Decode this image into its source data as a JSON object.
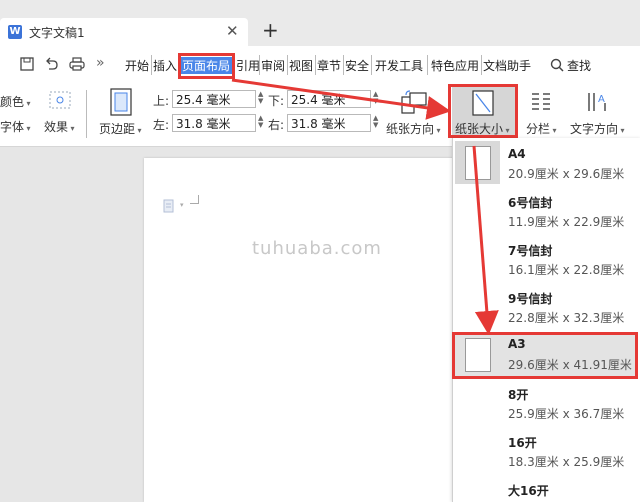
{
  "titlebar": {
    "doc_title": "文字文稿1",
    "close": "✕",
    "new_tab": "+",
    "logo": "W"
  },
  "menu": {
    "overflow": "»",
    "items": [
      "开始",
      "插入",
      "页面布局",
      "引用",
      "审阅",
      "视图",
      "章节",
      "安全",
      "开发工具",
      "特色应用",
      "文档助手"
    ],
    "active": "页面布局",
    "search": "查找"
  },
  "ribbon": {
    "color_label": "颜色",
    "font_label": "字体",
    "effect_label": "效果",
    "margins_label": "页边距",
    "top_label": "上:",
    "top_value": "25.4 毫米",
    "bottom_label": "下:",
    "bottom_value": "25.4 毫米",
    "left_label": "左:",
    "left_value": "31.8 毫米",
    "right_label": "右:",
    "right_value": "31.8 毫米",
    "orientation_label": "纸张方向",
    "size_label": "纸张大小",
    "columns_label": "分栏",
    "text_direction_label": "文字方向"
  },
  "watermark": "tuhuaba.com",
  "paper_sizes": [
    {
      "name": "A4",
      "width": "20.9厘米",
      "height": "29.6厘米"
    },
    {
      "name": "6号信封",
      "width": "11.9厘米",
      "height": "22.9厘米"
    },
    {
      "name": "7号信封",
      "width": "16.1厘米",
      "height": "22.8厘米"
    },
    {
      "name": "9号信封",
      "width": "22.8厘米",
      "height": "32.3厘米"
    },
    {
      "name": "A3",
      "width": "29.6厘米",
      "height": "41.91厘米"
    },
    {
      "name": "8开",
      "width": "25.9厘米",
      "height": "36.7厘米"
    },
    {
      "name": "16开",
      "width": "18.3厘米",
      "height": "25.9厘米"
    },
    {
      "name": "大16开",
      "width": "",
      "height": ""
    }
  ],
  "dims_sep": "x",
  "colors": {
    "accent": "#4a86e8",
    "highlight": "#e53935",
    "selected_bg": "#d9d9d9"
  }
}
